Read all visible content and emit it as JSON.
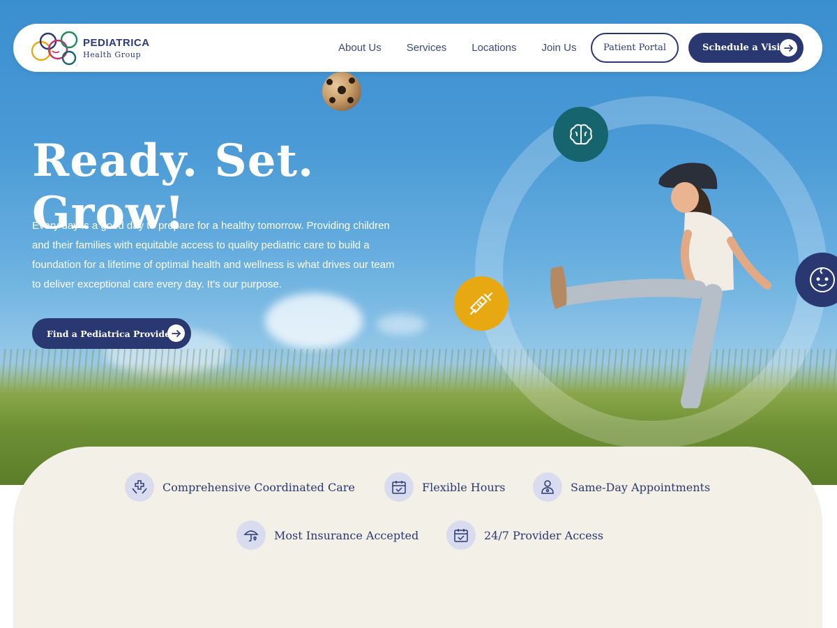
{
  "brand": {
    "name": "PEDIATRICA",
    "subtitle": "Health Group"
  },
  "nav": {
    "links": [
      "About Us",
      "Services",
      "Locations",
      "Join Us"
    ],
    "portal_label": "Patient Portal",
    "schedule_label": "Schedule a Visit"
  },
  "hero": {
    "title": "Ready. Set. Grow!",
    "body": "Every day is a good day to prepare for a healthy tomorrow. Providing children and their families with equitable access to quality pediatric care to build a foundation for a lifetime of optimal health and wellness is what drives our team to deliver exceptional care every day. It’s our purpose.",
    "cta_label": "Find a Pediatrica Provider"
  },
  "badges": [
    {
      "icon": "brain-icon",
      "color": "#16656e"
    },
    {
      "icon": "syringe-icon",
      "color": "#e8a812"
    },
    {
      "icon": "baby-face-icon",
      "color": "#2a3872"
    }
  ],
  "features": [
    {
      "icon": "care-hands-icon",
      "label": "Comprehensive Coordinated Care"
    },
    {
      "icon": "calendar-icon",
      "label": "Flexible Hours"
    },
    {
      "icon": "doctor-icon",
      "label": "Same-Day Appointments"
    },
    {
      "icon": "umbrella-heart-icon",
      "label": "Most Insurance Accepted"
    },
    {
      "icon": "calendar-check-icon",
      "label": "24/7 Provider Access"
    }
  ],
  "colors": {
    "navy": "#2a3872",
    "teal": "#16656e",
    "gold": "#e8a812",
    "panel": "#f3f0e7",
    "icon_bg": "#d9dcee"
  }
}
